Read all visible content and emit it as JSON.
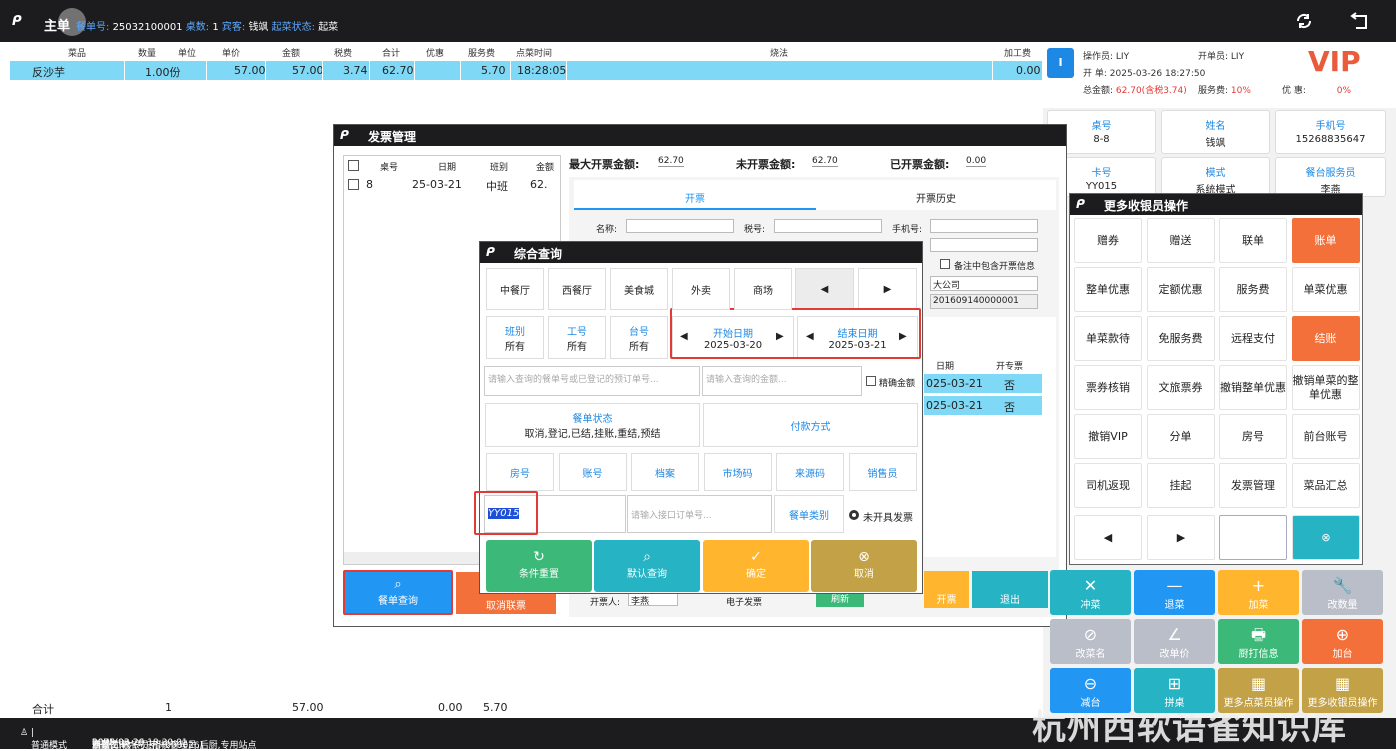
{
  "topbar": {
    "title": "主单",
    "order_label": "餐单号:",
    "order_no": "25032100001",
    "table_count_label": "桌数:",
    "table_count": "1",
    "guest_label": "宾客:",
    "guest": "钱飒",
    "status_label": "起菜状态:",
    "status": "起菜"
  },
  "order_table": {
    "headers": [
      "菜品",
      "数量",
      "单位",
      "单价",
      "金额",
      "税费",
      "合计",
      "优惠",
      "服务费",
      "点菜时间",
      "烧法",
      "加工费"
    ],
    "row": {
      "name": "反沙芋",
      "qty": "1.00份",
      "price": "57.00",
      "amount": "57.00",
      "tax": "3.74",
      "total": "62.70",
      "service": "5.70",
      "time": "18:28:05",
      "proc_fee": "0.00"
    },
    "total_row": {
      "label": "合计",
      "qty": "1",
      "amount": "57.00",
      "discount": "0.00",
      "service": "5.70"
    }
  },
  "footer": {
    "mode": "普通模式",
    "shift_label": "班别:",
    "shift": "2",
    "staff_label": "工号:",
    "staff": "李燕[LIY]",
    "bizdate_label": "营业日期:",
    "bizdate": "2025-03-20",
    "now_label": "当前时间:",
    "now": "2025-03-26 18:30:01",
    "role_label": "角色:",
    "role": "点菜员,收银员,稽核管理员,后厨,专用站点",
    "site_label": "站点:",
    "site": "00WY",
    "hotel_label": "酒店:",
    "hotel": "西软二十六号店[H000026]"
  },
  "watermark": "杭州西软语雀知识库",
  "operator": {
    "badge": "I",
    "op_label": "操作员:",
    "op": "LIY",
    "opener_label": "开单员:",
    "opener": "LIY",
    "open_label": "开 单:",
    "open_time": "2025-03-26 18:27:50",
    "total_label": "总金额:",
    "total": "62.70(含税3.74)",
    "service_label": "服务费:",
    "service": "10%",
    "discount_label": "优 惠:",
    "discount": "0%",
    "vip": "VIP"
  },
  "cards": [
    {
      "label": "桌号",
      "value": "8-8"
    },
    {
      "label": "姓名",
      "value": "钱飒"
    },
    {
      "label": "手机号",
      "value": "15268835647"
    },
    {
      "label": "卡号",
      "value": "YY015"
    },
    {
      "label": "模式",
      "value": "系统模式"
    },
    {
      "label": "餐台服务员",
      "value": "李燕"
    }
  ],
  "func_buttons": [
    {
      "label": "冲菜",
      "glyph": "✕"
    },
    {
      "label": "退菜",
      "glyph": "—"
    },
    {
      "label": "加菜",
      "glyph": "+"
    },
    {
      "label": "改数量",
      "glyph": "🔧"
    },
    {
      "label": "改菜名",
      "glyph": "⊘"
    },
    {
      "label": "改单价",
      "glyph": "∠"
    },
    {
      "label": "厨打信息",
      "glyph": "🖶"
    },
    {
      "label": "加台",
      "glyph": "⊕"
    },
    {
      "label": "减台",
      "glyph": "⊖"
    },
    {
      "label": "拼桌",
      "glyph": "⊞"
    },
    {
      "label": "更多点菜员操作",
      "glyph": "▦"
    },
    {
      "label": "更多收银员操作",
      "glyph": "▦"
    }
  ],
  "invoice": {
    "title": "发票管理",
    "list_headers": [
      "桌号",
      "日期",
      "班别",
      "金额"
    ],
    "list_row": {
      "table": "8",
      "date": "25-03-21",
      "shift": "中班",
      "amount": "62."
    },
    "max_label": "最大开票金额:",
    "max": "62.70",
    "unissued_label": "未开票金额:",
    "unissued": "62.70",
    "issued_label": "已开票金额:",
    "issued": "0.00",
    "tabs": [
      "开票",
      "开票历史"
    ],
    "name_label": "名称:",
    "tax_label": "税号:",
    "phone_label": "手机号:",
    "remark_check": "备注中包含开票信息",
    "company": "大公司",
    "code": "201609140000001",
    "hist_headers": [
      "日期",
      "开专票"
    ],
    "hist_rows": [
      {
        "date": "025-03-21",
        "flag": "否"
      },
      {
        "date": "025-03-21",
        "flag": "否"
      }
    ],
    "order_query": "餐单查询",
    "cancel_link": "取消联票",
    "open_btn": "开票",
    "exit_btn": "退出",
    "refresh": "刷新",
    "issuer_label": "开票人:",
    "issuer": "李燕",
    "e_invoice": "电子发票"
  },
  "more_ops": {
    "title": "更多收银员操作",
    "buttons": [
      "赠券",
      "赠送",
      "联单",
      "账单",
      "整单优惠",
      "定额优惠",
      "服务费",
      "单菜优惠",
      "单菜款待",
      "免服务费",
      "远程支付",
      "结账",
      "票券核销",
      "文旅票券",
      "撤销整单优惠",
      "撤销单菜的整单优惠",
      "撤销VIP",
      "分单",
      "房号",
      "前台账号",
      "司机返现",
      "挂起",
      "发票管理",
      "菜品汇总"
    ]
  },
  "query": {
    "title": "综合查询",
    "venues": [
      "中餐厅",
      "西餐厅",
      "美食城",
      "外卖",
      "商场"
    ],
    "filters": [
      {
        "label": "班别",
        "value": "所有"
      },
      {
        "label": "工号",
        "value": "所有"
      },
      {
        "label": "台号",
        "value": "所有"
      }
    ],
    "start_label": "开始日期",
    "start": "2025-03-20",
    "end_label": "结束日期",
    "end": "2025-03-21",
    "order_placeholder": "请输入查询的餐单号或已登记的预订单号...",
    "amount_placeholder": "请输入查询的金额...",
    "exact": "精确金额",
    "status_label": "餐单状态",
    "status_value": "取消,登记,已结,挂账,重结,预结",
    "pay": "付款方式",
    "row_btns": [
      "房号",
      "账号",
      "档案",
      "市场码",
      "来源码",
      "销售员"
    ],
    "card_value": "YY015",
    "api_placeholder": "请输入接口订单号...",
    "category": "餐单类别",
    "not_invoiced": "未开具发票",
    "actions": [
      "条件重置",
      "默认查询",
      "确定",
      "取消"
    ]
  }
}
